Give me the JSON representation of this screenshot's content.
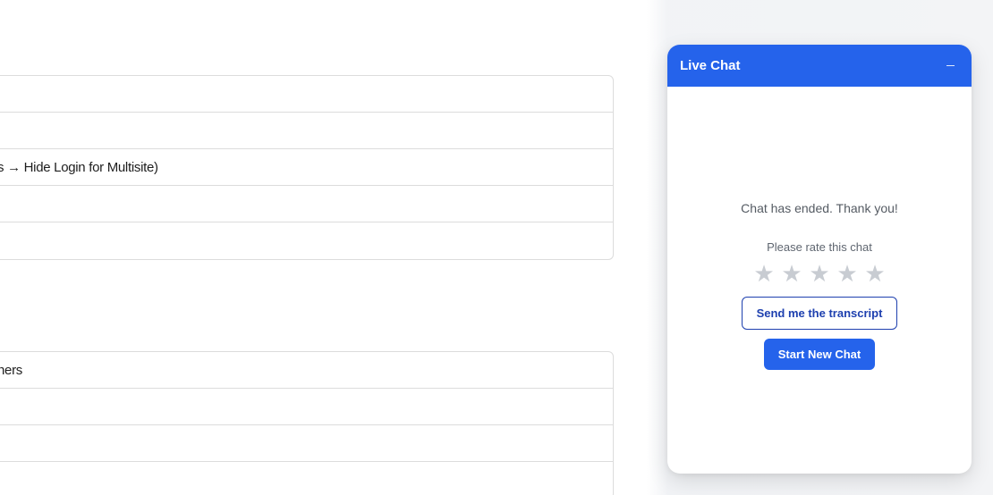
{
  "background": {
    "table_top_rows": [
      "",
      "",
      "s → Hide Login for Multisite)",
      "",
      ""
    ],
    "table_bottom_rows": [
      "ners",
      "",
      "",
      ""
    ]
  },
  "chat": {
    "title": "Live Chat",
    "minimize_icon": "minimize-icon",
    "ended_message": "Chat has ended. Thank you!",
    "rate_prompt": "Please rate this chat",
    "stars": [
      "★",
      "★",
      "★",
      "★",
      "★"
    ],
    "transcript_button": "Send me the transcript",
    "new_chat_button": "Start New Chat",
    "colors": {
      "accent": "#2563eb",
      "outline": "#1e40af",
      "star_inactive": "#c8ccd2"
    }
  }
}
